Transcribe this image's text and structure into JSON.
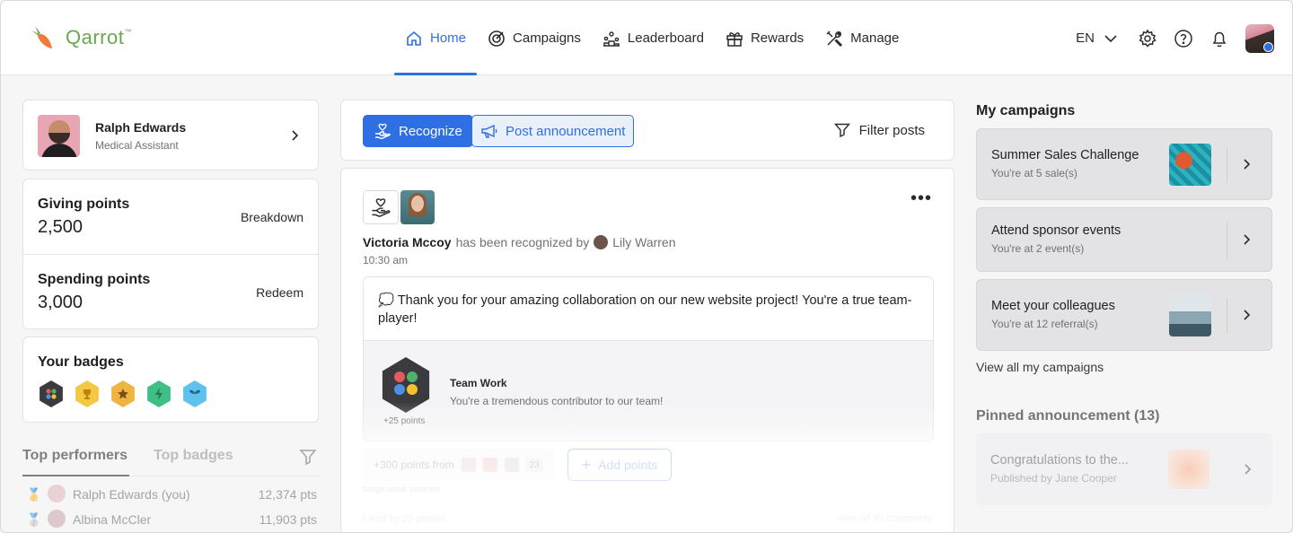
{
  "brand": {
    "name": "Qarrot",
    "tm": "™"
  },
  "nav": [
    {
      "label": "Home",
      "icon": "home-icon",
      "active": true
    },
    {
      "label": "Campaigns",
      "icon": "target-icon",
      "active": false
    },
    {
      "label": "Leaderboard",
      "icon": "leaderboard-icon",
      "active": false
    },
    {
      "label": "Rewards",
      "icon": "gift-icon",
      "active": false
    },
    {
      "label": "Manage",
      "icon": "tools-icon",
      "active": false
    }
  ],
  "header": {
    "language": "EN"
  },
  "profile": {
    "name": "Ralph Edwards",
    "role": "Medical Assistant"
  },
  "points": {
    "giving": {
      "label": "Giving points",
      "value": "2,500",
      "link": "Breakdown"
    },
    "spending": {
      "label": "Spending points",
      "value": "3,000",
      "link": "Redeem"
    }
  },
  "badges": {
    "title": "Your badges"
  },
  "performers": {
    "tab_active": "Top performers",
    "tab_inactive": "Top badges",
    "rows": [
      {
        "name": "Ralph Edwards (you)",
        "points": "12,374 pts"
      },
      {
        "name": "Albina McCler",
        "points": "11,903 pts"
      }
    ]
  },
  "actions": {
    "recognize": "Recognize",
    "post_announcement": "Post announcement",
    "filter": "Filter posts"
  },
  "post": {
    "recipient": "Victoria Mccoy",
    "verb": "has been recognized by",
    "giver": "Lily Warren",
    "time": "10:30 am",
    "message": "💭 Thank you for your amazing collaboration on our new website project! You're a true team-player!",
    "badge_title": "Team Work",
    "badge_desc": "You're a tremendous contributor to our team!",
    "badge_points": "+25 points",
    "points_from": "+300 points from",
    "points_from_count": "23",
    "add_points": "Add points",
    "meta_small": "badge.value.awarded",
    "footer_left": "Liked by 28 people",
    "footer_right": "View all 45 comments"
  },
  "campaigns": {
    "title": "My campaigns",
    "items": [
      {
        "name": "Summer Sales Challenge",
        "progress": "You're at 5 sale(s)"
      },
      {
        "name": "Attend sponsor events",
        "progress": "You're at 2 event(s)"
      },
      {
        "name": "Meet your colleagues",
        "progress": "You're at 12 referral(s)"
      }
    ],
    "view_all": "View all my campaigns"
  },
  "pinned": {
    "title": "Pinned announcement (13)",
    "item": {
      "name": "Congratulations to the...",
      "sub": "Published by Jane Cooper"
    }
  },
  "colors": {
    "accent": "#2f6fe4",
    "brand": "#6aa84f"
  }
}
